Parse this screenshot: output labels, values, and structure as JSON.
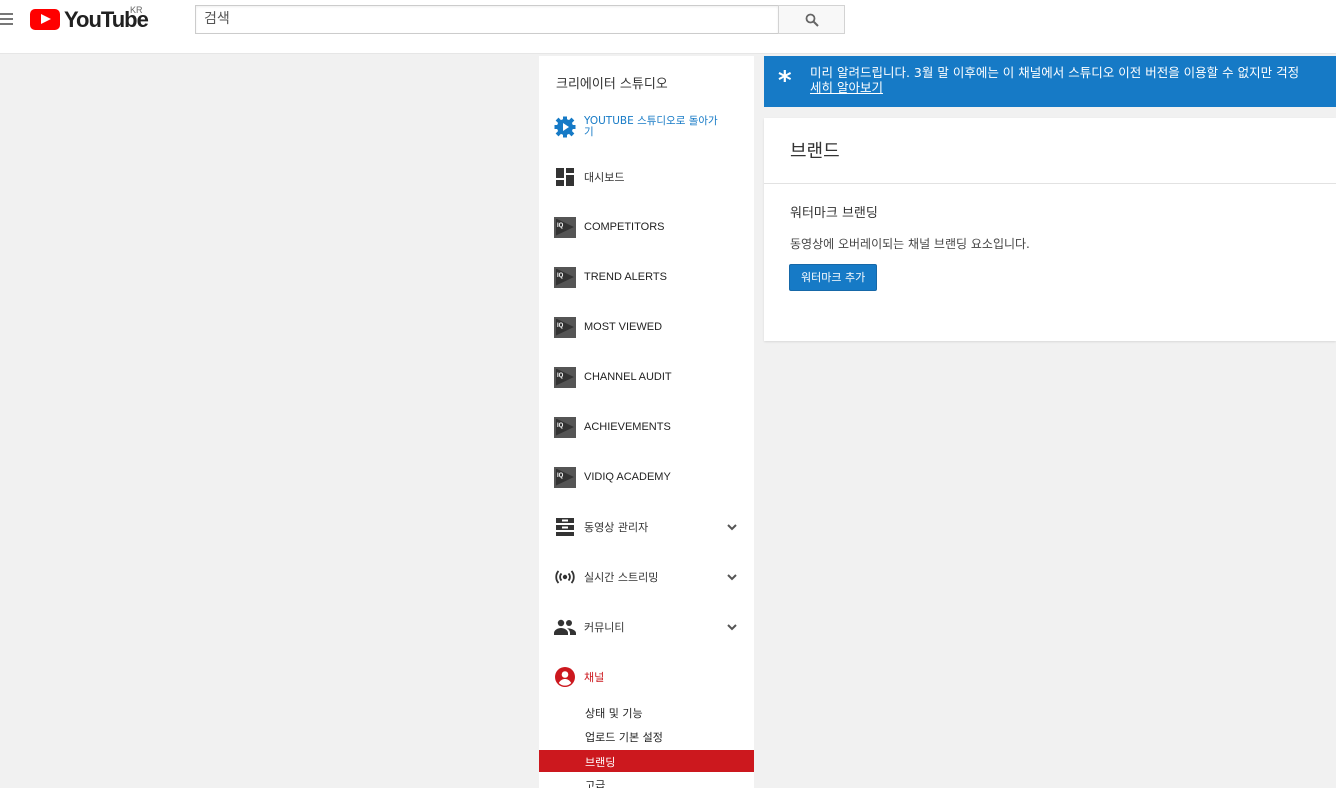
{
  "header": {
    "logo_text": "YouTube",
    "country": "KR",
    "search_placeholder": "검색"
  },
  "sidebar": {
    "title": "크리에이터 스튜디오",
    "items": [
      {
        "label": "YOUTUBE 스튜디오로 돌아가기",
        "icon": "gear-play-icon"
      },
      {
        "label": "대시보드",
        "icon": "dashboard-icon"
      },
      {
        "label": "COMPETITORS",
        "icon": "vidiq-icon"
      },
      {
        "label": "TREND ALERTS",
        "icon": "vidiq-icon"
      },
      {
        "label": "MOST VIEWED",
        "icon": "vidiq-icon"
      },
      {
        "label": "CHANNEL AUDIT",
        "icon": "vidiq-icon"
      },
      {
        "label": "ACHIEVEMENTS",
        "icon": "vidiq-icon"
      },
      {
        "label": "VIDIQ ACADEMY",
        "icon": "vidiq-icon"
      },
      {
        "label": "동영상 관리자",
        "icon": "video-manager-icon"
      },
      {
        "label": "실시간 스트리밍",
        "icon": "live-icon"
      },
      {
        "label": "커뮤니티",
        "icon": "community-icon"
      },
      {
        "label": "채널",
        "icon": "channel-icon"
      }
    ],
    "channel_sub": [
      {
        "label": "상태 및 기능"
      },
      {
        "label": "업로드 기본 설정"
      },
      {
        "label": "브랜딩"
      },
      {
        "label": "고급"
      }
    ]
  },
  "alert": {
    "text": "미리 알려드립니다. 3월 말 이후에는 이 채널에서 스튜디오 이전 버전을 이용할 수 없지만 걱정",
    "link": "세히 알아보기"
  },
  "main": {
    "title": "브랜드",
    "section_title": "워터마크 브랜딩",
    "section_desc": "동영상에 오버레이되는 채널 브랜딩 요소입니다.",
    "add_button": "워터마크 추가"
  },
  "colors": {
    "accent_blue": "#167ac6",
    "active_red": "#cc181e"
  }
}
